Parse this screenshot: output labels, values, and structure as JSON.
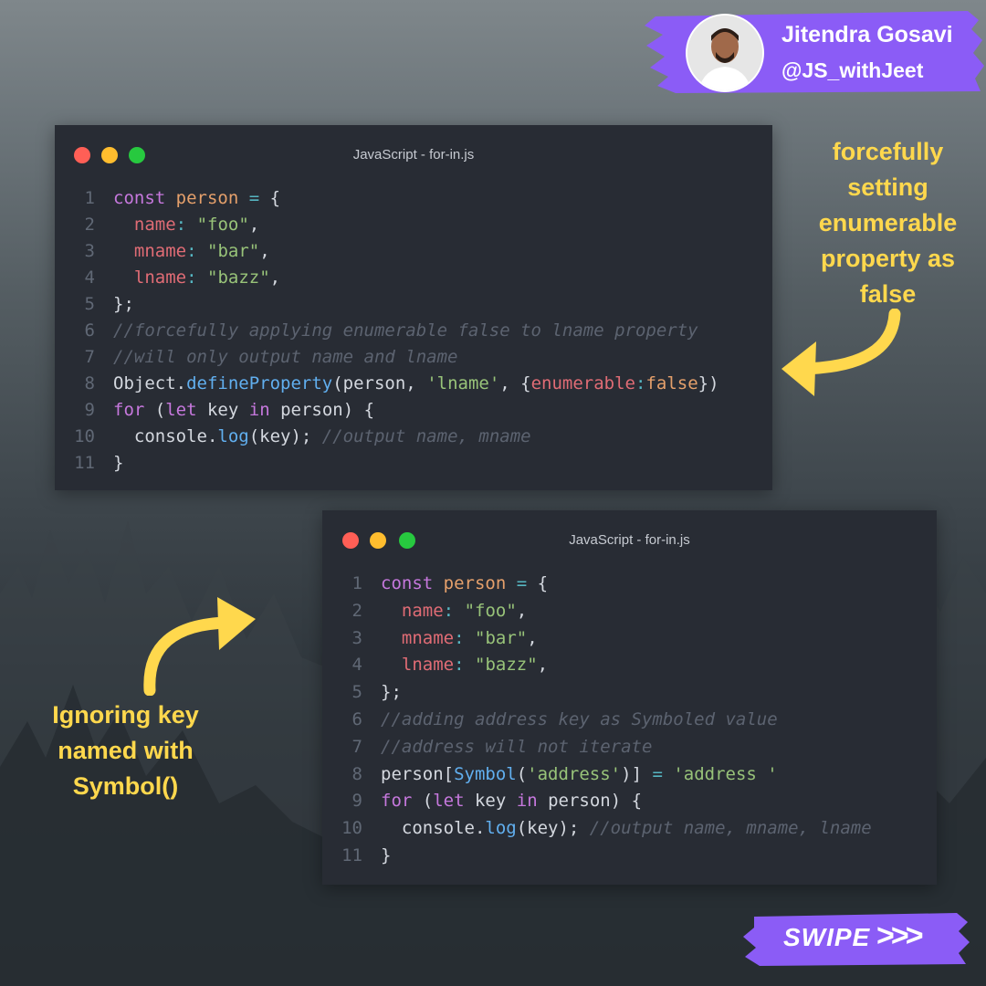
{
  "author": {
    "name": "Jitendra Gosavi",
    "handle": "@JS_withJeet",
    "avatar_icon": "person-avatar",
    "accent_color": "#8b5cf6"
  },
  "windows": [
    {
      "title": "JavaScript - for-in.js",
      "lines": [
        [
          [
            "kw",
            "const"
          ],
          [
            "pl",
            " "
          ],
          [
            "var",
            "person"
          ],
          [
            "pl",
            " "
          ],
          [
            "op",
            "="
          ],
          [
            "pl",
            " {"
          ]
        ],
        [
          [
            "pl",
            "  "
          ],
          [
            "prop",
            "name"
          ],
          [
            "op",
            ":"
          ],
          [
            "pl",
            " "
          ],
          [
            "str",
            "\"foo\""
          ],
          [
            "pl",
            ","
          ]
        ],
        [
          [
            "pl",
            "  "
          ],
          [
            "prop",
            "mname"
          ],
          [
            "op",
            ":"
          ],
          [
            "pl",
            " "
          ],
          [
            "str",
            "\"bar\""
          ],
          [
            "pl",
            ","
          ]
        ],
        [
          [
            "pl",
            "  "
          ],
          [
            "prop",
            "lname"
          ],
          [
            "op",
            ":"
          ],
          [
            "pl",
            " "
          ],
          [
            "str",
            "\"bazz\""
          ],
          [
            "pl",
            ","
          ]
        ],
        [
          [
            "pl",
            "};"
          ]
        ],
        [
          [
            "com",
            "//forcefully applying enumerable false to lname property"
          ]
        ],
        [
          [
            "com",
            "//will only output name and lname"
          ]
        ],
        [
          [
            "pl",
            "Object."
          ],
          [
            "fn",
            "defineProperty"
          ],
          [
            "pl",
            "(person, "
          ],
          [
            "str",
            "'lname'"
          ],
          [
            "pl",
            ", {"
          ],
          [
            "prop",
            "enumerable"
          ],
          [
            "op",
            ":"
          ],
          [
            "var",
            "false"
          ],
          [
            "pl",
            "})"
          ]
        ],
        [
          [
            "kw",
            "for"
          ],
          [
            "pl",
            " ("
          ],
          [
            "kw",
            "let"
          ],
          [
            "pl",
            " key "
          ],
          [
            "kw",
            "in"
          ],
          [
            "pl",
            " person) {"
          ]
        ],
        [
          [
            "pl",
            "  console."
          ],
          [
            "fn",
            "log"
          ],
          [
            "pl",
            "(key); "
          ],
          [
            "com",
            "//output name, mname"
          ]
        ],
        [
          [
            "pl",
            "}"
          ]
        ]
      ]
    },
    {
      "title": "JavaScript - for-in.js",
      "lines": [
        [
          [
            "kw",
            "const"
          ],
          [
            "pl",
            " "
          ],
          [
            "var",
            "person"
          ],
          [
            "pl",
            " "
          ],
          [
            "op",
            "="
          ],
          [
            "pl",
            " {"
          ]
        ],
        [
          [
            "pl",
            "  "
          ],
          [
            "prop",
            "name"
          ],
          [
            "op",
            ":"
          ],
          [
            "pl",
            " "
          ],
          [
            "str",
            "\"foo\""
          ],
          [
            "pl",
            ","
          ]
        ],
        [
          [
            "pl",
            "  "
          ],
          [
            "prop",
            "mname"
          ],
          [
            "op",
            ":"
          ],
          [
            "pl",
            " "
          ],
          [
            "str",
            "\"bar\""
          ],
          [
            "pl",
            ","
          ]
        ],
        [
          [
            "pl",
            "  "
          ],
          [
            "prop",
            "lname"
          ],
          [
            "op",
            ":"
          ],
          [
            "pl",
            " "
          ],
          [
            "str",
            "\"bazz\""
          ],
          [
            "pl",
            ","
          ]
        ],
        [
          [
            "pl",
            "};"
          ]
        ],
        [
          [
            "com",
            "//adding address key as Symboled value"
          ]
        ],
        [
          [
            "com",
            "//address will not iterate"
          ]
        ],
        [
          [
            "pl",
            "person["
          ],
          [
            "fn",
            "Symbol"
          ],
          [
            "pl",
            "("
          ],
          [
            "str",
            "'address'"
          ],
          [
            "pl",
            ")] "
          ],
          [
            "op",
            "="
          ],
          [
            "pl",
            " "
          ],
          [
            "str",
            "'address '"
          ]
        ],
        [
          [
            "kw",
            "for"
          ],
          [
            "pl",
            " ("
          ],
          [
            "kw",
            "let"
          ],
          [
            "pl",
            " key "
          ],
          [
            "kw",
            "in"
          ],
          [
            "pl",
            " person) {"
          ]
        ],
        [
          [
            "pl",
            "  console."
          ],
          [
            "fn",
            "log"
          ],
          [
            "pl",
            "(key); "
          ],
          [
            "com",
            "//output name, mname, lname"
          ]
        ],
        [
          [
            "pl",
            "}"
          ]
        ]
      ]
    }
  ],
  "annotations": {
    "top_right": "forcefully setting enumerable property as false",
    "bottom_left": "Ignoring key named with Symbol()"
  },
  "swipe": {
    "label": "SWIPE",
    "chevrons": ">>>"
  },
  "colors": {
    "annotation": "#ffd84d",
    "window_bg": "#282c34"
  }
}
